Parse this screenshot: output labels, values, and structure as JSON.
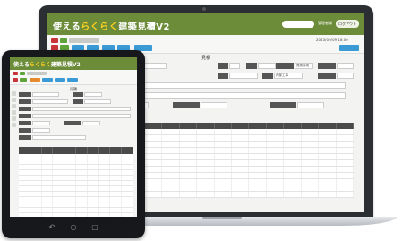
{
  "app": {
    "logo_text": "使える",
    "logo_mark": "らくらく",
    "logo_suffix": "建築見積V2",
    "brand_color": "#6c8c3a"
  },
  "laptop": {
    "header": {
      "user": "管理者様",
      "logout": "ログアウト"
    },
    "toolbar": {
      "date": "2023/09/09 18:00"
    },
    "page_title": "見積",
    "form": {
      "customer_label": "取引先",
      "person_label": "担当",
      "status_label": "ステータス",
      "field_project": "現場名",
      "field_status_value": "見積作成",
      "field_work_value": "内部工事"
    }
  },
  "tablet": {
    "page_title": "見積",
    "nav": {
      "back": "↶",
      "home": "○",
      "menu": "▢"
    }
  },
  "icons": [
    "search-icon",
    "user-icon",
    "pdf-icon",
    "print-icon",
    "back-icon",
    "home-icon",
    "menu-icon"
  ]
}
